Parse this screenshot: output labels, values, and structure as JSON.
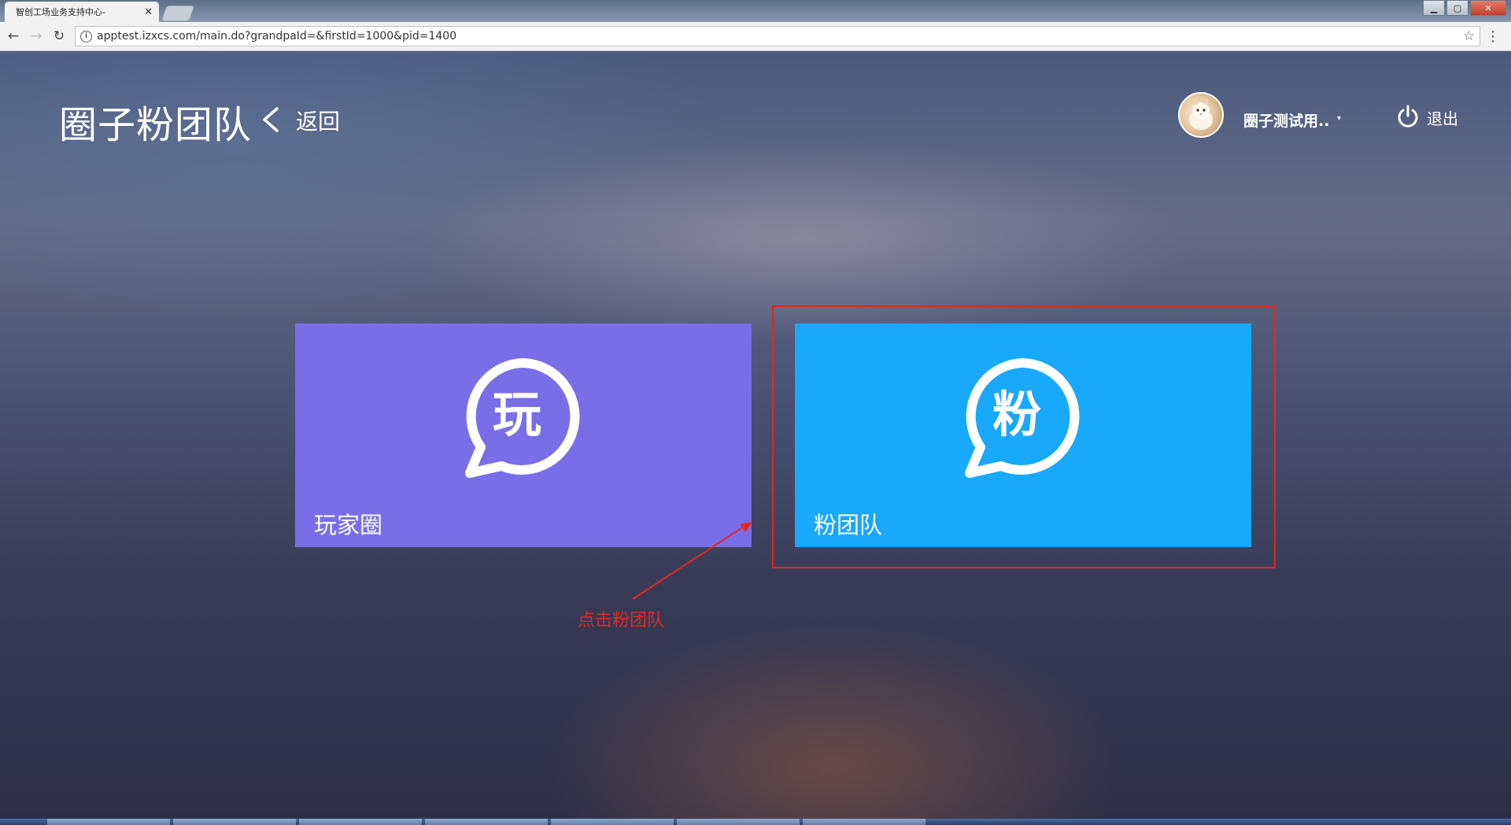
{
  "browser": {
    "tab_title": "智创工场业务支持中心-",
    "tab_close": "✕",
    "url": "apptest.izxcs.com/main.do?grandpaId=&firstId=1000&pid=1400",
    "back": "←",
    "forward": "→",
    "reload": "↻",
    "info": "i",
    "star": "☆",
    "menu": "⋮",
    "win_min": "▁",
    "win_max": "▢",
    "win_close": "✕"
  },
  "header": {
    "title": "圈子粉团队",
    "back_label": "返回",
    "username": "圈子测试用..",
    "caret": "▾",
    "logout_label": "退出"
  },
  "cards": [
    {
      "icon_char": "玩",
      "label": "玩家圈",
      "color": "#796ee8",
      "icon": "chat-bubble-icon"
    },
    {
      "icon_char": "粉",
      "label": "粉团队",
      "color": "#18a8fc",
      "icon": "chat-bubble-icon"
    }
  ],
  "annotation": {
    "text": "点击粉团队",
    "color": "#e4261f"
  }
}
